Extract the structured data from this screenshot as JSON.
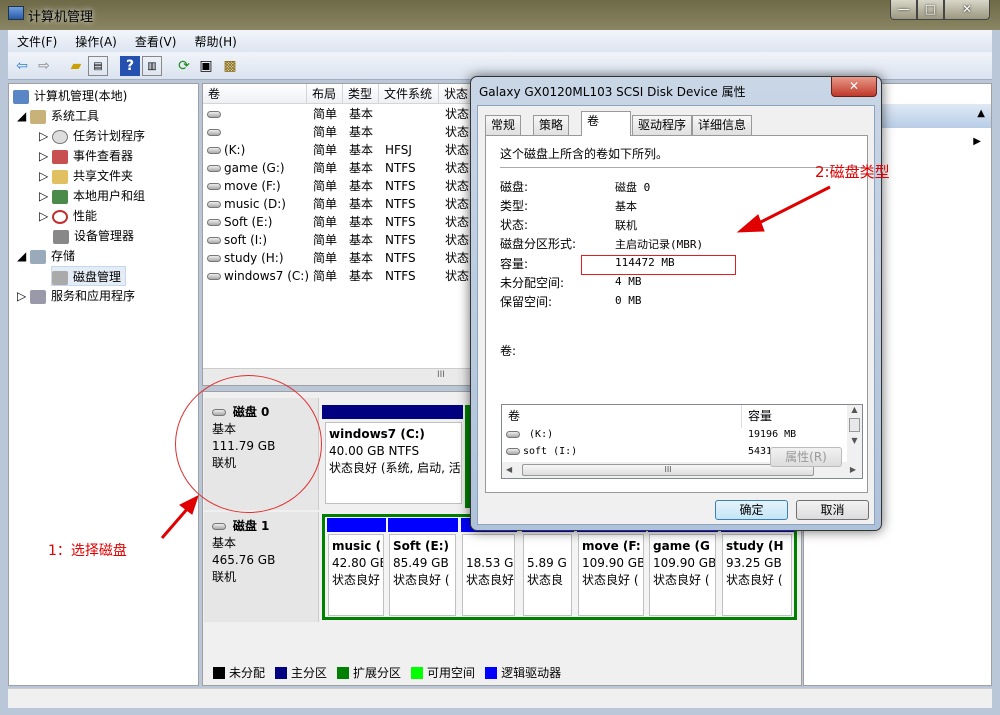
{
  "window": {
    "title": "计算机管理",
    "min": "—",
    "max": "□",
    "close": "✕"
  },
  "menu": [
    "文件(F)",
    "操作(A)",
    "查看(V)",
    "帮助(H)"
  ],
  "tree": [
    {
      "label": "计算机管理(本地)"
    },
    {
      "label": "系统工具"
    },
    {
      "label": "任务计划程序"
    },
    {
      "label": "事件查看器"
    },
    {
      "label": "共享文件夹"
    },
    {
      "label": "本地用户和组"
    },
    {
      "label": "性能"
    },
    {
      "label": "设备管理器"
    },
    {
      "label": "存储"
    },
    {
      "label": "磁盘管理"
    },
    {
      "label": "服务和应用程序"
    }
  ],
  "volumes": {
    "headers": [
      "卷",
      "布局",
      "类型",
      "文件系统",
      "状态"
    ],
    "rows": [
      [
        "",
        "简单",
        "基本",
        "",
        "状态"
      ],
      [
        "",
        "简单",
        "基本",
        "",
        "状态"
      ],
      [
        "(K:)",
        "简单",
        "基本",
        "HFSJ",
        "状态"
      ],
      [
        "game (G:)",
        "简单",
        "基本",
        "NTFS",
        "状态"
      ],
      [
        "move (F:)",
        "简单",
        "基本",
        "NTFS",
        "状态"
      ],
      [
        "music (D:)",
        "简单",
        "基本",
        "NTFS",
        "状态"
      ],
      [
        "Soft (E:)",
        "简单",
        "基本",
        "NTFS",
        "状态"
      ],
      [
        "soft (I:)",
        "简单",
        "基本",
        "NTFS",
        "状态"
      ],
      [
        "study (H:)",
        "简单",
        "基本",
        "NTFS",
        "状态"
      ],
      [
        "windows7 (C:)",
        "简单",
        "基本",
        "NTFS",
        "状态"
      ]
    ],
    "scroll_grip": "III"
  },
  "disks": [
    {
      "name": "磁盘 0",
      "type": "基本",
      "size": "111.79 GB",
      "status": "联机",
      "partitions": [
        {
          "name": "windows7  (C:)",
          "size": "40.00 GB NTFS",
          "state": "状态良好 (系统, 启动, 活"
        }
      ]
    },
    {
      "name": "磁盘 1",
      "type": "基本",
      "size": "465.76 GB",
      "status": "联机",
      "partitions": [
        {
          "name": "music  (",
          "size": "42.80 GB",
          "state": "状态良好"
        },
        {
          "name": "Soft  (E:)",
          "size": "85.49 GB",
          "state": "状态良好 ("
        },
        {
          "name": "",
          "size": "18.53 GB",
          "state": "状态良好"
        },
        {
          "name": "",
          "size": "5.89 G",
          "state": "状态良"
        },
        {
          "name": "move  (F:",
          "size": "109.90 GB",
          "state": "状态良好 ("
        },
        {
          "name": "game  (G",
          "size": "109.90 GB",
          "state": "状态良好 ("
        },
        {
          "name": "study  (H",
          "size": "93.25 GB",
          "state": "状态良好 ("
        }
      ]
    }
  ],
  "legend": [
    {
      "label": "未分配",
      "color": "#000000"
    },
    {
      "label": "主分区",
      "color": "#000080"
    },
    {
      "label": "扩展分区",
      "color": "#008000"
    },
    {
      "label": "可用空间",
      "color": "#00ff00"
    },
    {
      "label": "逻辑驱动器",
      "color": "#0000ff"
    }
  ],
  "dialog": {
    "title": "Galaxy GX0120ML103 SCSI Disk Device 属性",
    "tabs": [
      "常规",
      "策略",
      "卷",
      "驱动程序",
      "详细信息"
    ],
    "intro": "这个磁盘上所含的卷如下所列。",
    "fields": [
      {
        "label": "磁盘:",
        "value": "磁盘 0"
      },
      {
        "label": "类型:",
        "value": "基本"
      },
      {
        "label": "状态:",
        "value": "联机"
      },
      {
        "label": "磁盘分区形式:",
        "value": "主启动记录(MBR)"
      },
      {
        "label": "容量:",
        "value": "114472 MB"
      },
      {
        "label": "未分配空间:",
        "value": "4 MB"
      },
      {
        "label": "保留空间:",
        "value": "0 MB"
      }
    ],
    "volumes_label": "卷:",
    "vol_headers": [
      "卷",
      "容量"
    ],
    "vol_rows": [
      {
        "name": "(K:)",
        "cap": "19196 MB"
      },
      {
        "name": "soft (I:)",
        "cap": "54311 MB"
      }
    ],
    "scroll_grip": "III",
    "properties_btn": "属性(R)",
    "ok": "确定",
    "cancel": "取消",
    "close": "✕"
  },
  "annotations": {
    "step1": "1：选择磁盘",
    "step2": "2:磁盘类型"
  }
}
